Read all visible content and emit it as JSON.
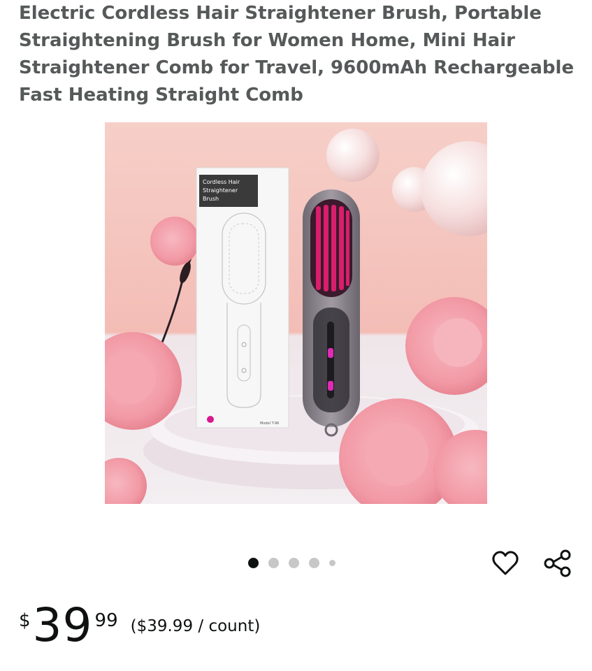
{
  "product": {
    "title": "Electric Cordless Hair Straightener Brush, Portable Straightening Brush for Women Home, Mini Hair Straightener Comb for Travel, 9600mAh Rechargeable Fast Heating Straight Comb"
  },
  "image": {
    "box_label_lines": [
      "Cordless Hair",
      "Straightener",
      "Brush"
    ],
    "model_text": "Model T-96",
    "dots_total": 5,
    "dot_active_index": 0
  },
  "actions": {
    "favorite_icon": "heart-icon",
    "share_icon": "share-icon"
  },
  "price": {
    "symbol": "$",
    "whole": "39",
    "fraction": "99",
    "unit_price": "($39.99 / count)"
  }
}
